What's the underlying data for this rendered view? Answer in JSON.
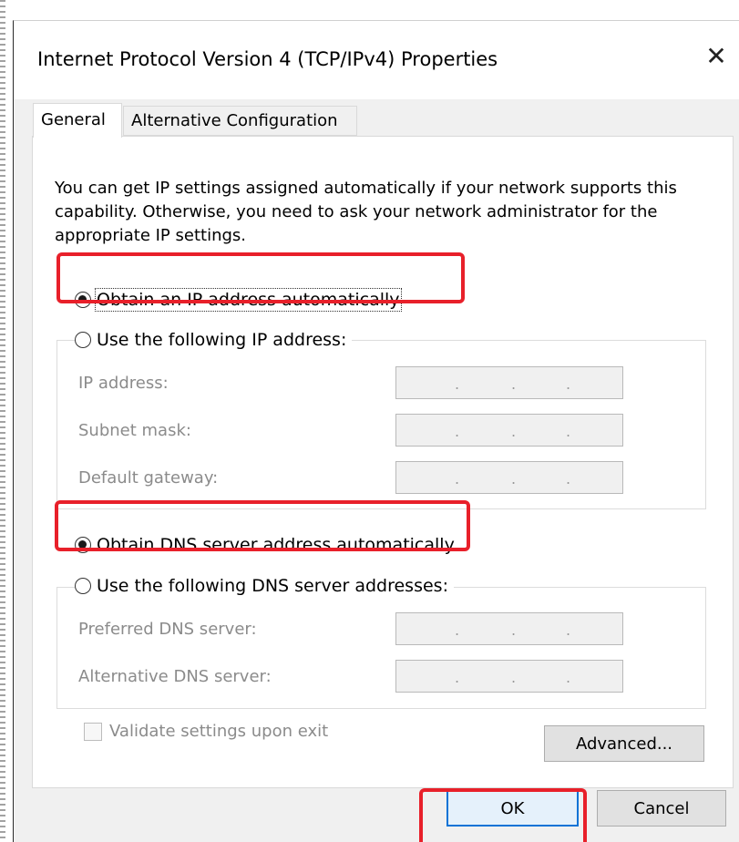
{
  "window": {
    "title": "Internet Protocol Version 4 (TCP/IPv4) Properties"
  },
  "tabs": [
    {
      "label": "General"
    },
    {
      "label": "Alternative Configuration"
    }
  ],
  "description": "You can get IP settings assigned automatically if your network supports this capability. Otherwise, you need to ask your network administrator for the appropriate IP settings.",
  "ip": {
    "auto_label": "Obtain an IP address automatically",
    "manual_label": "Use the following IP address:",
    "selected": "auto",
    "fields": [
      {
        "label": "IP address:",
        "value": ".   .   ."
      },
      {
        "label": "Subnet mask:",
        "value": ".   .   ."
      },
      {
        "label": "Default gateway:",
        "value": ".   .   ."
      }
    ]
  },
  "dns": {
    "auto_label": "Obtain DNS server address automatically",
    "manual_label": "Use the following DNS server addresses:",
    "selected": "auto",
    "fields": [
      {
        "label": "Preferred DNS server:",
        "value": ".   .   ."
      },
      {
        "label": "Alternative DNS server:",
        "value": ".   .   ."
      }
    ]
  },
  "validate_label": "Validate settings upon exit",
  "buttons": {
    "advanced": "Advanced...",
    "ok": "OK",
    "cancel": "Cancel"
  },
  "colors": {
    "highlight": "#e8202a",
    "primary_button_border": "#0a73d6"
  }
}
